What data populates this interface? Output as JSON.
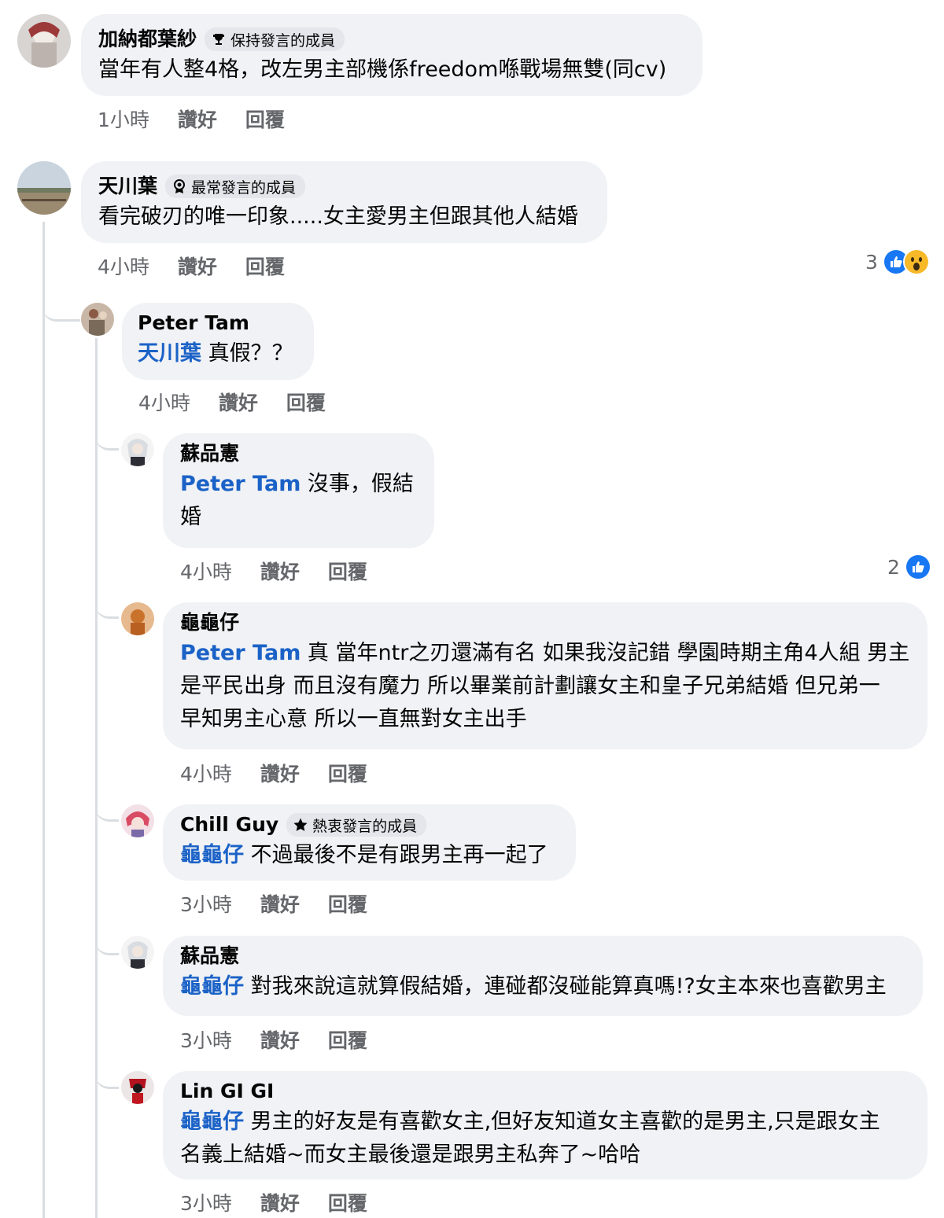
{
  "time_labels_note": "",
  "comments": [
    {
      "name": "加納都葉紗",
      "badge": "保持發言的成員",
      "badge_icon": "trophy-icon",
      "text": "當年有人整4格，改左男主部機係freedom喺戰場無雙(同cv)",
      "time": "1小時",
      "like": "讚好",
      "reply": "回覆"
    },
    {
      "name": "天川葉",
      "badge": "最常發言的成員",
      "badge_icon": "medal-icon",
      "text": "看完破刃的唯一印象.....女主愛男主但跟其他人結婚",
      "time": "4小時",
      "like": "讚好",
      "reply": "回覆",
      "reaction_count": "3",
      "reaction_icons": [
        "like-icon",
        "wow-icon"
      ]
    }
  ],
  "replies": [
    {
      "name": "Peter Tam",
      "mention": "天川葉",
      "text": "真假？？",
      "time": "4小時",
      "like": "讚好",
      "reply": "回覆"
    },
    {
      "name": "蘇品憲",
      "mention": "Peter Tam",
      "text": "沒事，假結",
      "text2": "婚",
      "time": "4小時",
      "like": "讚好",
      "reply": "回覆",
      "reaction_count": "2",
      "reaction_icons": [
        "like-icon"
      ]
    },
    {
      "name": "龜龜仔",
      "mention": "Peter Tam",
      "text": "真 當年ntr之刃還滿有名 如果我沒記錯 學園時期主角4人組 男主",
      "text2": "是平民出身 而且沒有魔力 所以畢業前計劃讓女主和皇子兄弟結婚 但兄弟一",
      "text3": "早知男主心意 所以一直無對女主出手",
      "time": "4小時",
      "like": "讚好",
      "reply": "回覆"
    },
    {
      "name": "Chill Guy",
      "badge": "熱衷發言的成員",
      "badge_icon": "star-icon",
      "mention": "龜龜仔",
      "text": "不過最後不是有跟男主再一起了",
      "time": "3小時",
      "like": "讚好",
      "reply": "回覆"
    },
    {
      "name": "蘇品憲",
      "mention": "龜龜仔",
      "text": "對我來說這就算假結婚，連碰都沒碰能算真嗎!?女主本來也喜歡男主",
      "time": "3小時",
      "like": "讚好",
      "reply": "回覆"
    },
    {
      "name": "Lin GI GI",
      "mention": "龜龜仔",
      "text": "男主的好友是有喜歡女主,但好友知道女主喜歡的是男主,只是跟女主",
      "text2": "名義上結婚~而女主最後還是跟男主私奔了~哈哈",
      "time": "3小時",
      "like": "讚好",
      "reply": "回覆"
    }
  ],
  "colors": {
    "bubble": "#f0f2f5",
    "mention": "#1b62c7",
    "meta": "#65676b",
    "like_blue": "#1877f2",
    "wow_yellow": "#f7b928"
  }
}
